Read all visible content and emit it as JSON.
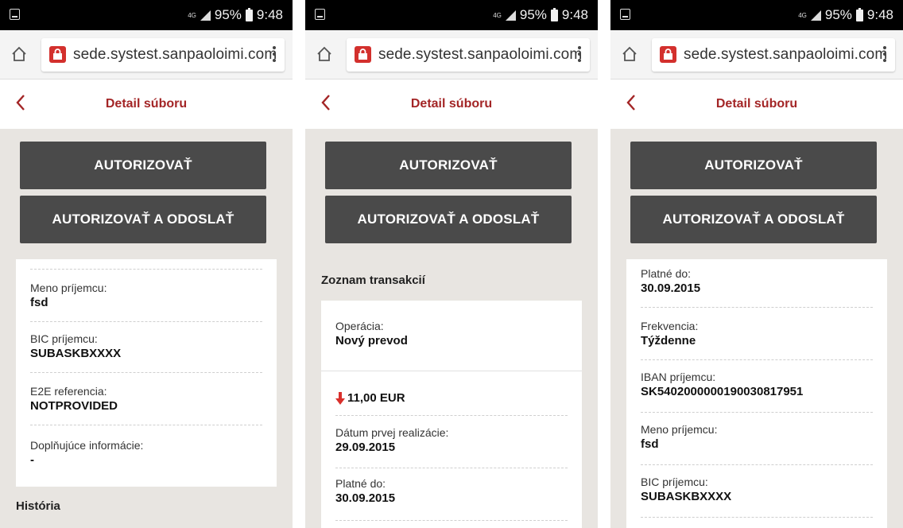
{
  "status_bar": {
    "network": "4G",
    "battery_percent": "95%",
    "time": "9:48"
  },
  "browser": {
    "url": "sede.systest.sanpaoloimi.com"
  },
  "header": {
    "title": "Detail súboru"
  },
  "buttons": {
    "authorize": "AUTORIZOVAŤ",
    "authorize_send": "AUTORIZOVAŤ A ODOSLAŤ"
  },
  "screen1": {
    "fields": [
      {
        "label": "Meno príjemcu:",
        "value": "fsd"
      },
      {
        "label": "BIC príjemcu:",
        "value": "SUBASKBXXXX"
      },
      {
        "label": "E2E referencia:",
        "value": "NOTPROVIDED"
      },
      {
        "label": "Doplňujúce informácie:",
        "value": "-"
      }
    ],
    "history_heading": "História"
  },
  "screen2": {
    "transactions_heading": "Zoznam transakcií",
    "operation": {
      "label": "Operácia:",
      "value": "Nový prevod"
    },
    "amount": "11,00 EUR",
    "fields": [
      {
        "label": "Dátum prvej realizácie:",
        "value": "29.09.2015"
      },
      {
        "label": "Platné do:",
        "value": "30.09.2015"
      }
    ]
  },
  "screen3": {
    "fields": [
      {
        "label": "Platné do:",
        "value": "30.09.2015"
      },
      {
        "label": "Frekvencia:",
        "value": "Týždenne"
      },
      {
        "label": "IBAN príjemcu:",
        "value": "SK5402000000190030817951"
      },
      {
        "label": "Meno príjemcu:",
        "value": "fsd"
      },
      {
        "label": "BIC príjemcu:",
        "value": "SUBASKBXXXX"
      }
    ]
  },
  "colors": {
    "accent": "#a32526",
    "button": "#4a4a4a",
    "debit_arrow": "#d9302c"
  }
}
